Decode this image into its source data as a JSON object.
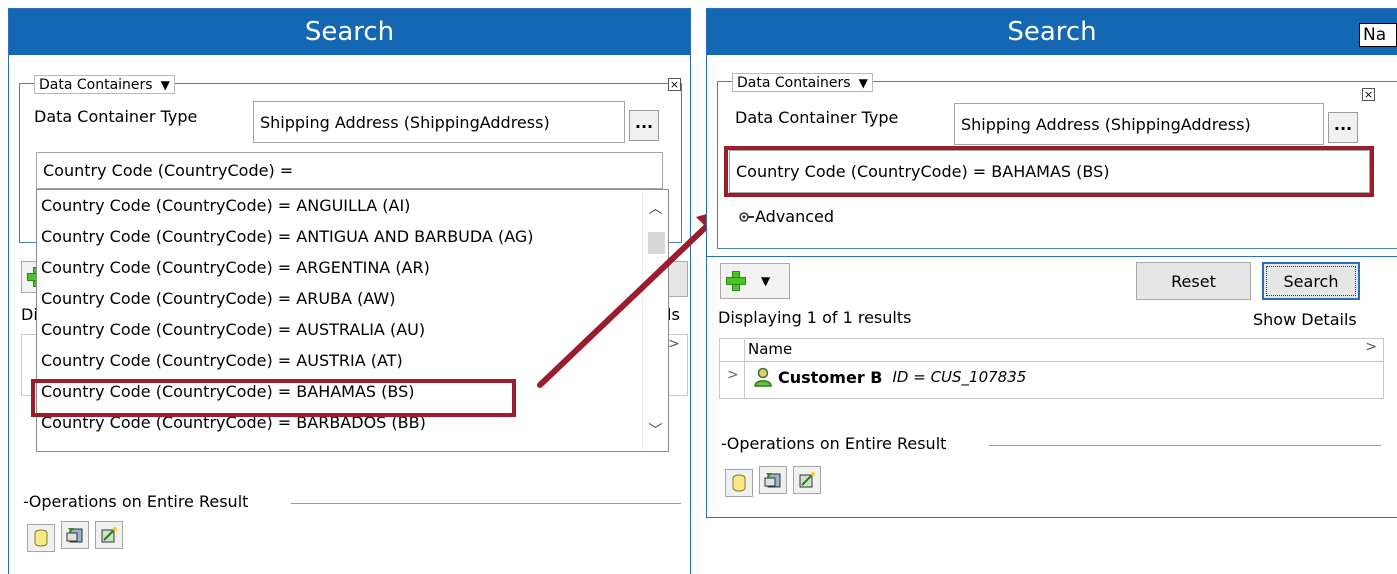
{
  "left": {
    "title": "Search",
    "legend_label": "Data Containers",
    "dc_type_label": "Data Container Type",
    "dc_type_value": "Shipping Address (ShippingAddress)",
    "browse_label": "...",
    "criteria_value": "Country Code (CountryCode) =",
    "options": [
      "Country Code (CountryCode) = ANGUILLA (AI)",
      "Country Code (CountryCode) = ANTIGUA AND BARBUDA (AG)",
      "Country Code (CountryCode) = ARGENTINA (AR)",
      "Country Code (CountryCode) = ARUBA (AW)",
      "Country Code (CountryCode) = AUSTRALIA (AU)",
      "Country Code (CountryCode) = AUSTRIA (AT)",
      "Country Code (CountryCode) = BAHAMAS (BS)",
      "Country Code (CountryCode) = BARBADOS (BB)"
    ],
    "partial_di": "Di",
    "partial_ls": "ls",
    "operations_label": "Operations on Entire Result"
  },
  "right": {
    "title": "Search",
    "corner_text": "Na",
    "legend_label": "Data Containers",
    "dc_type_label": "Data Container Type",
    "dc_type_value": "Shipping Address (ShippingAddress)",
    "browse_label": "...",
    "criteria_value": "Country Code (CountryCode) = BAHAMAS (BS)",
    "advanced_label": "Advanced",
    "reset_label": "Reset",
    "search_label": "Search",
    "displaying": "Displaying 1 of 1 results",
    "show_details": "Show Details",
    "column_name": "Name",
    "result_name": "Customer B",
    "result_id": "ID = CUS_107835",
    "operations_label": "Operations on Entire Result"
  },
  "colors": {
    "title_bar": "#1468b3",
    "highlight": "#9b1c2a",
    "arrow": "#9b1c2a"
  }
}
